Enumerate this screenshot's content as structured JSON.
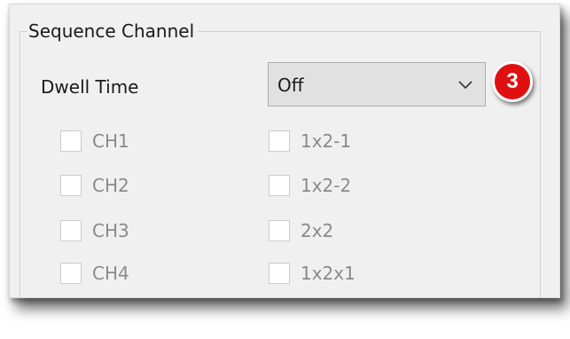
{
  "group": {
    "title": "Sequence Channel"
  },
  "dwell": {
    "label": "Dwell Time",
    "selected": "Off",
    "badge": "3"
  },
  "channels_left": [
    {
      "label": "CH1",
      "checked": false
    },
    {
      "label": "CH2",
      "checked": false
    },
    {
      "label": "CH3",
      "checked": false
    },
    {
      "label": "CH4",
      "checked": false
    }
  ],
  "channels_right": [
    {
      "label": "1x2-1",
      "checked": false
    },
    {
      "label": "1x2-2",
      "checked": false
    },
    {
      "label": "2x2",
      "checked": false
    },
    {
      "label": "1x2x1",
      "checked": false
    }
  ],
  "colors": {
    "panel_bg": "#f0f0f0",
    "badge": "#e01010",
    "disabled_text": "#8a8a8a"
  }
}
